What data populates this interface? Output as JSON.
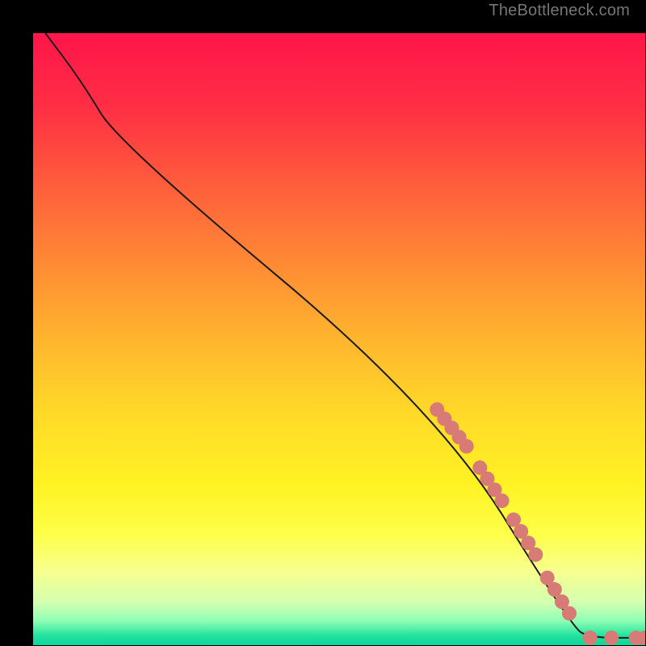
{
  "attribution": "TheBottleneck.com",
  "chart_data": {
    "type": "line",
    "title": "",
    "xlabel": "",
    "ylabel": "",
    "xlim": [
      0,
      100
    ],
    "ylim": [
      0,
      100
    ],
    "curve": [
      {
        "x": 2,
        "y": 100
      },
      {
        "x": 8,
        "y": 92
      },
      {
        "x": 14,
        "y": 82
      },
      {
        "x": 66,
        "y": 38.5
      },
      {
        "x": 88,
        "y": 3
      },
      {
        "x": 91,
        "y": 1.2
      },
      {
        "x": 100,
        "y": 1.2
      }
    ],
    "highlight_points": [
      {
        "x": 66.0,
        "y": 38.5
      },
      {
        "x": 67.2,
        "y": 37.0
      },
      {
        "x": 68.4,
        "y": 35.5
      },
      {
        "x": 69.6,
        "y": 34.0
      },
      {
        "x": 70.8,
        "y": 32.5
      },
      {
        "x": 73.0,
        "y": 29.0
      },
      {
        "x": 74.2,
        "y": 27.2
      },
      {
        "x": 75.4,
        "y": 25.4
      },
      {
        "x": 76.6,
        "y": 23.6
      },
      {
        "x": 78.5,
        "y": 20.5
      },
      {
        "x": 79.7,
        "y": 18.6
      },
      {
        "x": 80.9,
        "y": 16.7
      },
      {
        "x": 82.1,
        "y": 14.8
      },
      {
        "x": 84.0,
        "y": 11.0
      },
      {
        "x": 85.2,
        "y": 9.1
      },
      {
        "x": 86.4,
        "y": 7.1
      },
      {
        "x": 87.6,
        "y": 5.2
      },
      {
        "x": 91.0,
        "y": 1.2
      },
      {
        "x": 94.5,
        "y": 1.2
      },
      {
        "x": 98.5,
        "y": 1.2
      },
      {
        "x": 100.0,
        "y": 1.2
      }
    ],
    "gradient_stops": [
      {
        "pos": 0.0,
        "color": "#ff154a"
      },
      {
        "pos": 0.12,
        "color": "#ff2e44"
      },
      {
        "pos": 0.25,
        "color": "#ff5e3c"
      },
      {
        "pos": 0.38,
        "color": "#ff8b34"
      },
      {
        "pos": 0.5,
        "color": "#ffb52e"
      },
      {
        "pos": 0.62,
        "color": "#ffd928"
      },
      {
        "pos": 0.74,
        "color": "#fff324"
      },
      {
        "pos": 0.82,
        "color": "#feff4a"
      },
      {
        "pos": 0.88,
        "color": "#f7ff8f"
      },
      {
        "pos": 0.93,
        "color": "#d4ffb0"
      },
      {
        "pos": 0.96,
        "color": "#8effb4"
      },
      {
        "pos": 0.985,
        "color": "#20e29e"
      },
      {
        "pos": 1.0,
        "color": "#0dd699"
      }
    ],
    "line_color": "#1b1b1b",
    "point_fill": "#d87a75",
    "point_radius_px": 9
  }
}
